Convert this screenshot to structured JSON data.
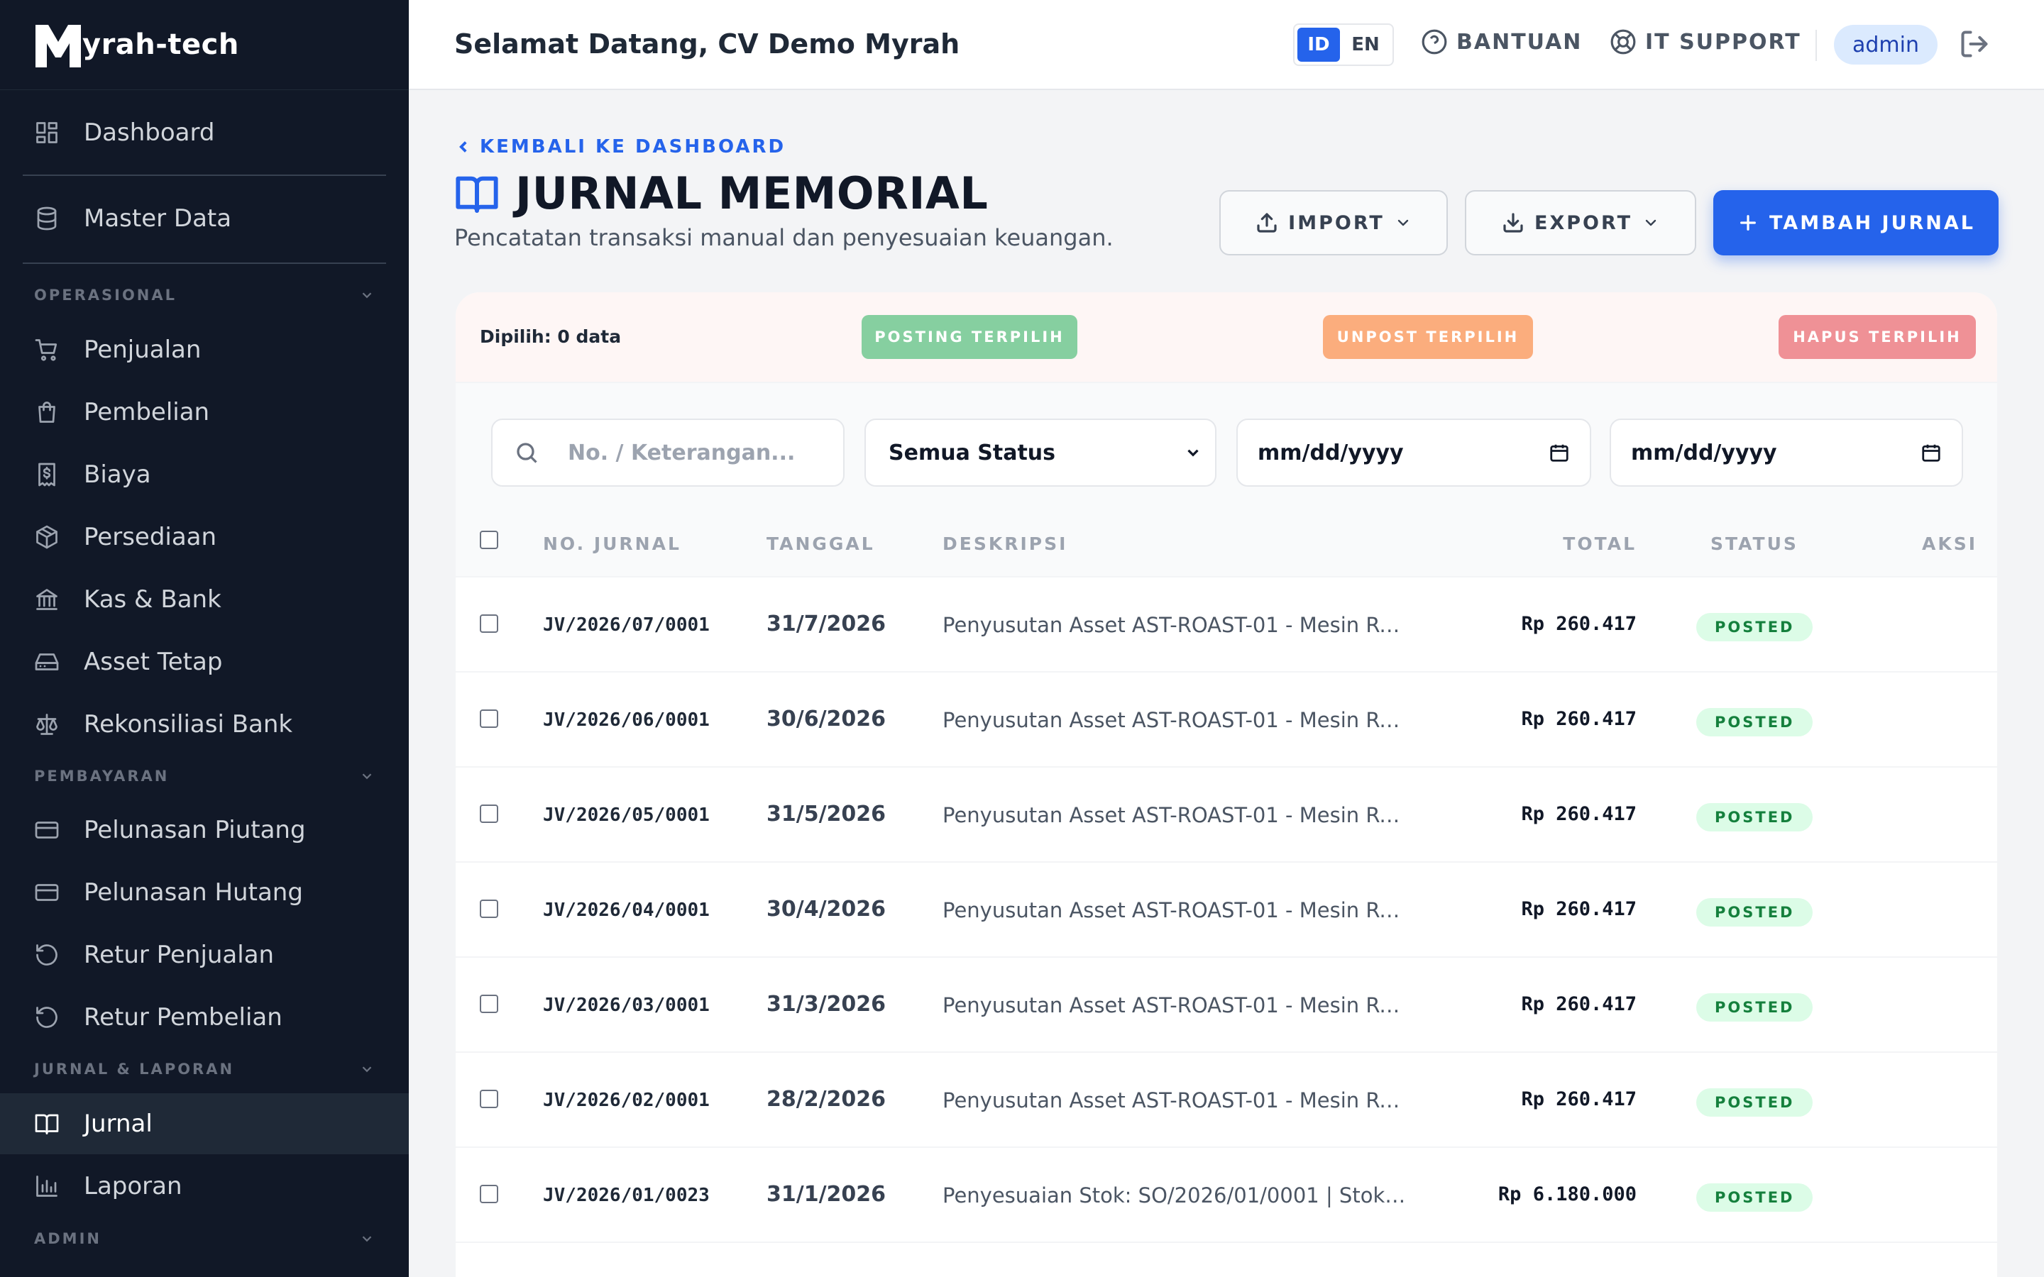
{
  "brand": {
    "name": "yrah-tech"
  },
  "sidebar": {
    "dashboard": "Dashboard",
    "master_data": "Master Data",
    "sections": {
      "operasional": "OPERASIONAL",
      "pembayaran": "PEMBAYARAN",
      "jurnal_laporan": "JURNAL & LAPORAN",
      "admin": "ADMIN"
    },
    "operasional_items": [
      "Penjualan",
      "Pembelian",
      "Biaya",
      "Persediaan",
      "Kas & Bank",
      "Asset Tetap",
      "Rekonsiliasi Bank"
    ],
    "pembayaran_items": [
      "Pelunasan Piutang",
      "Pelunasan Hutang",
      "Retur Penjualan",
      "Retur Pembelian"
    ],
    "jurnal_items": [
      "Jurnal",
      "Laporan"
    ],
    "active": "Jurnal"
  },
  "header": {
    "welcome": "Selamat Datang, CV Demo Myrah",
    "lang_id": "ID",
    "lang_en": "EN",
    "help": "BANTUAN",
    "it_support": "IT SUPPORT",
    "user": "admin"
  },
  "page": {
    "back": "KEMBALI KE DASHBOARD",
    "title": "JURNAL MEMORIAL",
    "subtitle": "Pencatatan transaksi manual dan penyesuaian keuangan.",
    "import": "IMPORT",
    "export": "EXPORT",
    "add": "TAMBAH JURNAL"
  },
  "bulk": {
    "selected": "Dipilih: 0 data",
    "post": "POSTING TERPILIH",
    "unpost": "UNPOST TERPILIH",
    "delete": "HAPUS TERPILIH",
    "colors": {
      "post": "#86cfa0",
      "unpost": "#fbad7d",
      "delete": "#ef9196"
    }
  },
  "filters": {
    "search_placeholder": "No. / Keterangan...",
    "status": "Semua Status",
    "date_from": "mm/dd/yyyy",
    "date_to": "mm/dd/yyyy"
  },
  "table": {
    "headers": {
      "no": "NO. JURNAL",
      "date": "TANGGAL",
      "desc": "DESKRIPSI",
      "total": "TOTAL",
      "status": "STATUS",
      "action": "AKSI"
    },
    "rows": [
      {
        "no": "JV/2026/07/0001",
        "date": "31/7/2026",
        "desc": "Penyusutan Asset AST-ROAST-01 - Mesin Ro...",
        "total": "Rp 260.417",
        "status": "POSTED"
      },
      {
        "no": "JV/2026/06/0001",
        "date": "30/6/2026",
        "desc": "Penyusutan Asset AST-ROAST-01 - Mesin Ro...",
        "total": "Rp 260.417",
        "status": "POSTED"
      },
      {
        "no": "JV/2026/05/0001",
        "date": "31/5/2026",
        "desc": "Penyusutan Asset AST-ROAST-01 - Mesin Ro...",
        "total": "Rp 260.417",
        "status": "POSTED"
      },
      {
        "no": "JV/2026/04/0001",
        "date": "30/4/2026",
        "desc": "Penyusutan Asset AST-ROAST-01 - Mesin Ro...",
        "total": "Rp 260.417",
        "status": "POSTED"
      },
      {
        "no": "JV/2026/03/0001",
        "date": "31/3/2026",
        "desc": "Penyusutan Asset AST-ROAST-01 - Mesin Ro...",
        "total": "Rp 260.417",
        "status": "POSTED"
      },
      {
        "no": "JV/2026/02/0001",
        "date": "28/2/2026",
        "desc": "Penyusutan Asset AST-ROAST-01 - Mesin Ro...",
        "total": "Rp 260.417",
        "status": "POSTED"
      },
      {
        "no": "JV/2026/01/0023",
        "date": "31/1/2026",
        "desc": "Penyesuaian Stok: SO/2026/01/0001 | Stok ...",
        "total": "Rp 6.180.000",
        "status": "POSTED"
      }
    ]
  },
  "colors": {
    "accent": "#2563eb",
    "sidebar": "#111827",
    "posted_bg": "#dcfce7",
    "posted_text": "#15803d"
  }
}
